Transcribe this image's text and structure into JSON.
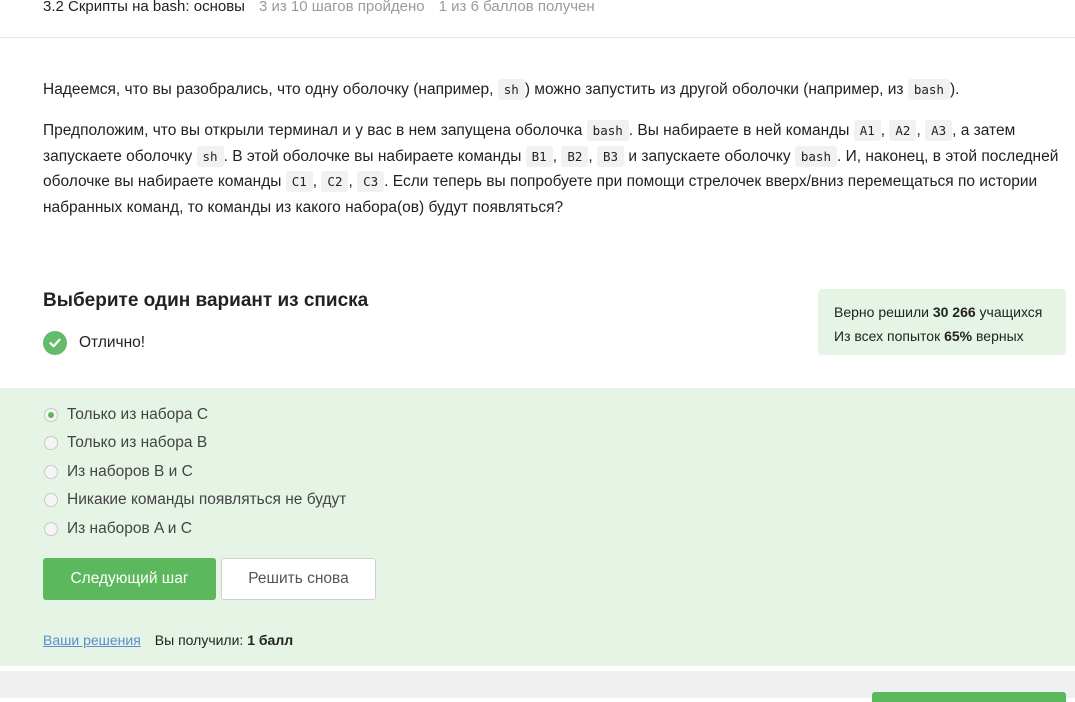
{
  "header": {
    "lesson_title": "3.2 Скрипты на bash: основы",
    "steps_progress": "3 из 10 шагов пройдено",
    "points_progress": "1 из 6 баллов  получен"
  },
  "question": {
    "p1": {
      "text_1": "Надеемся, что вы разобрались, что одну оболочку (например, ",
      "code_1": "sh",
      "text_2": ") можно запустить из другой оболочки (например, из ",
      "code_2": "bash",
      "text_3": ")."
    },
    "p2": {
      "t1": "Предположим, что вы открыли терминал и у вас в нем запущена оболочка ",
      "c1": "bash",
      "t2": ". Вы набираете в ней команды ",
      "c2": "A1",
      "t3": ", ",
      "c3": "A2",
      "t4": ", ",
      "c4": "A3",
      "t5": ", а затем запускаете оболочку ",
      "c5": "sh",
      "t6": ". В этой оболочке вы набираете команды ",
      "c6": "B1",
      "t7": ", ",
      "c7": "B2",
      "t8": ", ",
      "c8": "B3",
      "t9": " и запускаете оболочку ",
      "c9": "bash",
      "t10": ". И, наконец, в этой последней оболочке вы набираете команды ",
      "c10": "C1",
      "t11": ", ",
      "c11": "C2",
      "t12": ", ",
      "c12": "C3",
      "t13": ". Если теперь вы попробуете при помощи стрелочек вверх/вниз перемещаться по истории набранных команд, то команды из какого набора(ов) будут появляться?"
    }
  },
  "quiz": {
    "title": "Выберите один вариант из списка",
    "feedback": "Отлично!",
    "options": [
      {
        "label": "Только из набора C",
        "selected": true
      },
      {
        "label": "Только из набора B",
        "selected": false
      },
      {
        "label": "Из наборов B и C",
        "selected": false
      },
      {
        "label": "Никакие команды появляться не будут",
        "selected": false
      },
      {
        "label": "Из наборов A и C",
        "selected": false
      }
    ],
    "next_button": "Следующий шаг",
    "retry_button": "Решить снова",
    "solutions_link": "Ваши решения",
    "score_label": "Вы получили:",
    "score_value": "1 балл"
  },
  "stats": {
    "solved_prefix": "Верно решили ",
    "solved_count": "30 266",
    "solved_suffix": " учащихся",
    "attempts_prefix": "Из всех попыток ",
    "attempts_percent": "65%",
    "attempts_suffix": " верных"
  },
  "colors": {
    "accent_green": "#5cb85c",
    "panel_green": "#e6f4e6",
    "link_blue": "#5a8ccf"
  }
}
